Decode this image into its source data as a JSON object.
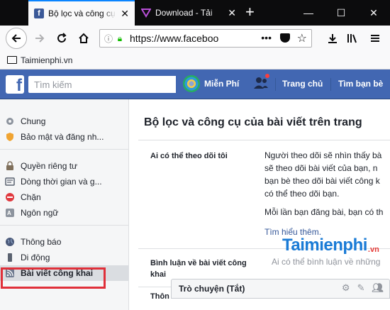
{
  "browser": {
    "tabs": [
      {
        "title": "Bộ lọc và công cụ",
        "active": true
      },
      {
        "title": "Download - Tải",
        "active": false
      }
    ],
    "new_tab_symbol": "+",
    "url": "https://www.faceboo",
    "bookmark_folder": "Taimienphi.vn"
  },
  "facebook": {
    "logo_letter": "f",
    "search_placeholder": "Tìm kiếm",
    "profile_name": "Miễn Phí",
    "nav_home": "Trang chủ",
    "nav_find_friends": "Tìm bạn bè"
  },
  "settings_nav": {
    "group1": [
      {
        "label": "Chung",
        "icon": "gear-icon"
      },
      {
        "label": "Bảo mật và đăng nh...",
        "icon": "shield-icon"
      }
    ],
    "group2": [
      {
        "label": "Quyền riêng tư",
        "icon": "lock-icon"
      },
      {
        "label": "Dòng thời gian và g...",
        "icon": "timeline-icon"
      },
      {
        "label": "Chặn",
        "icon": "block-icon"
      },
      {
        "label": "Ngôn ngữ",
        "icon": "language-icon"
      }
    ],
    "group3": [
      {
        "label": "Thông báo",
        "icon": "globe-icon"
      },
      {
        "label": "Di động",
        "icon": "mobile-icon"
      },
      {
        "label": "Bài viết công khai",
        "icon": "rss-icon",
        "selected": true
      },
      {
        "label": "Thông",
        "icon": "info-icon"
      }
    ]
  },
  "content": {
    "title": "Bộ lọc và công cụ của bài viết trên trang",
    "row1_label": "Ai có thể theo dõi tôi",
    "row1_lines": [
      "Người theo dõi sẽ nhìn thấy bà",
      "sẽ theo dõi bài viết của bạn, n",
      "bạn bè theo dõi bài viết công k",
      "có thể theo dõi bạn."
    ],
    "row1_extra": "Mỗi lần bạn đăng bài, bạn có th",
    "row1_learn_more": "Tìm hiểu thêm.",
    "row2_label_line1": "Bình luận về bài viết công",
    "row2_label_line2": "khai",
    "row2_value": "Ai có thể bình luận về những",
    "row3_label": "Thôn"
  },
  "chat": {
    "label": "Trò chuyện (Tắt)"
  },
  "watermark": {
    "text": "Taimienphi",
    "suffix": ".vn"
  }
}
